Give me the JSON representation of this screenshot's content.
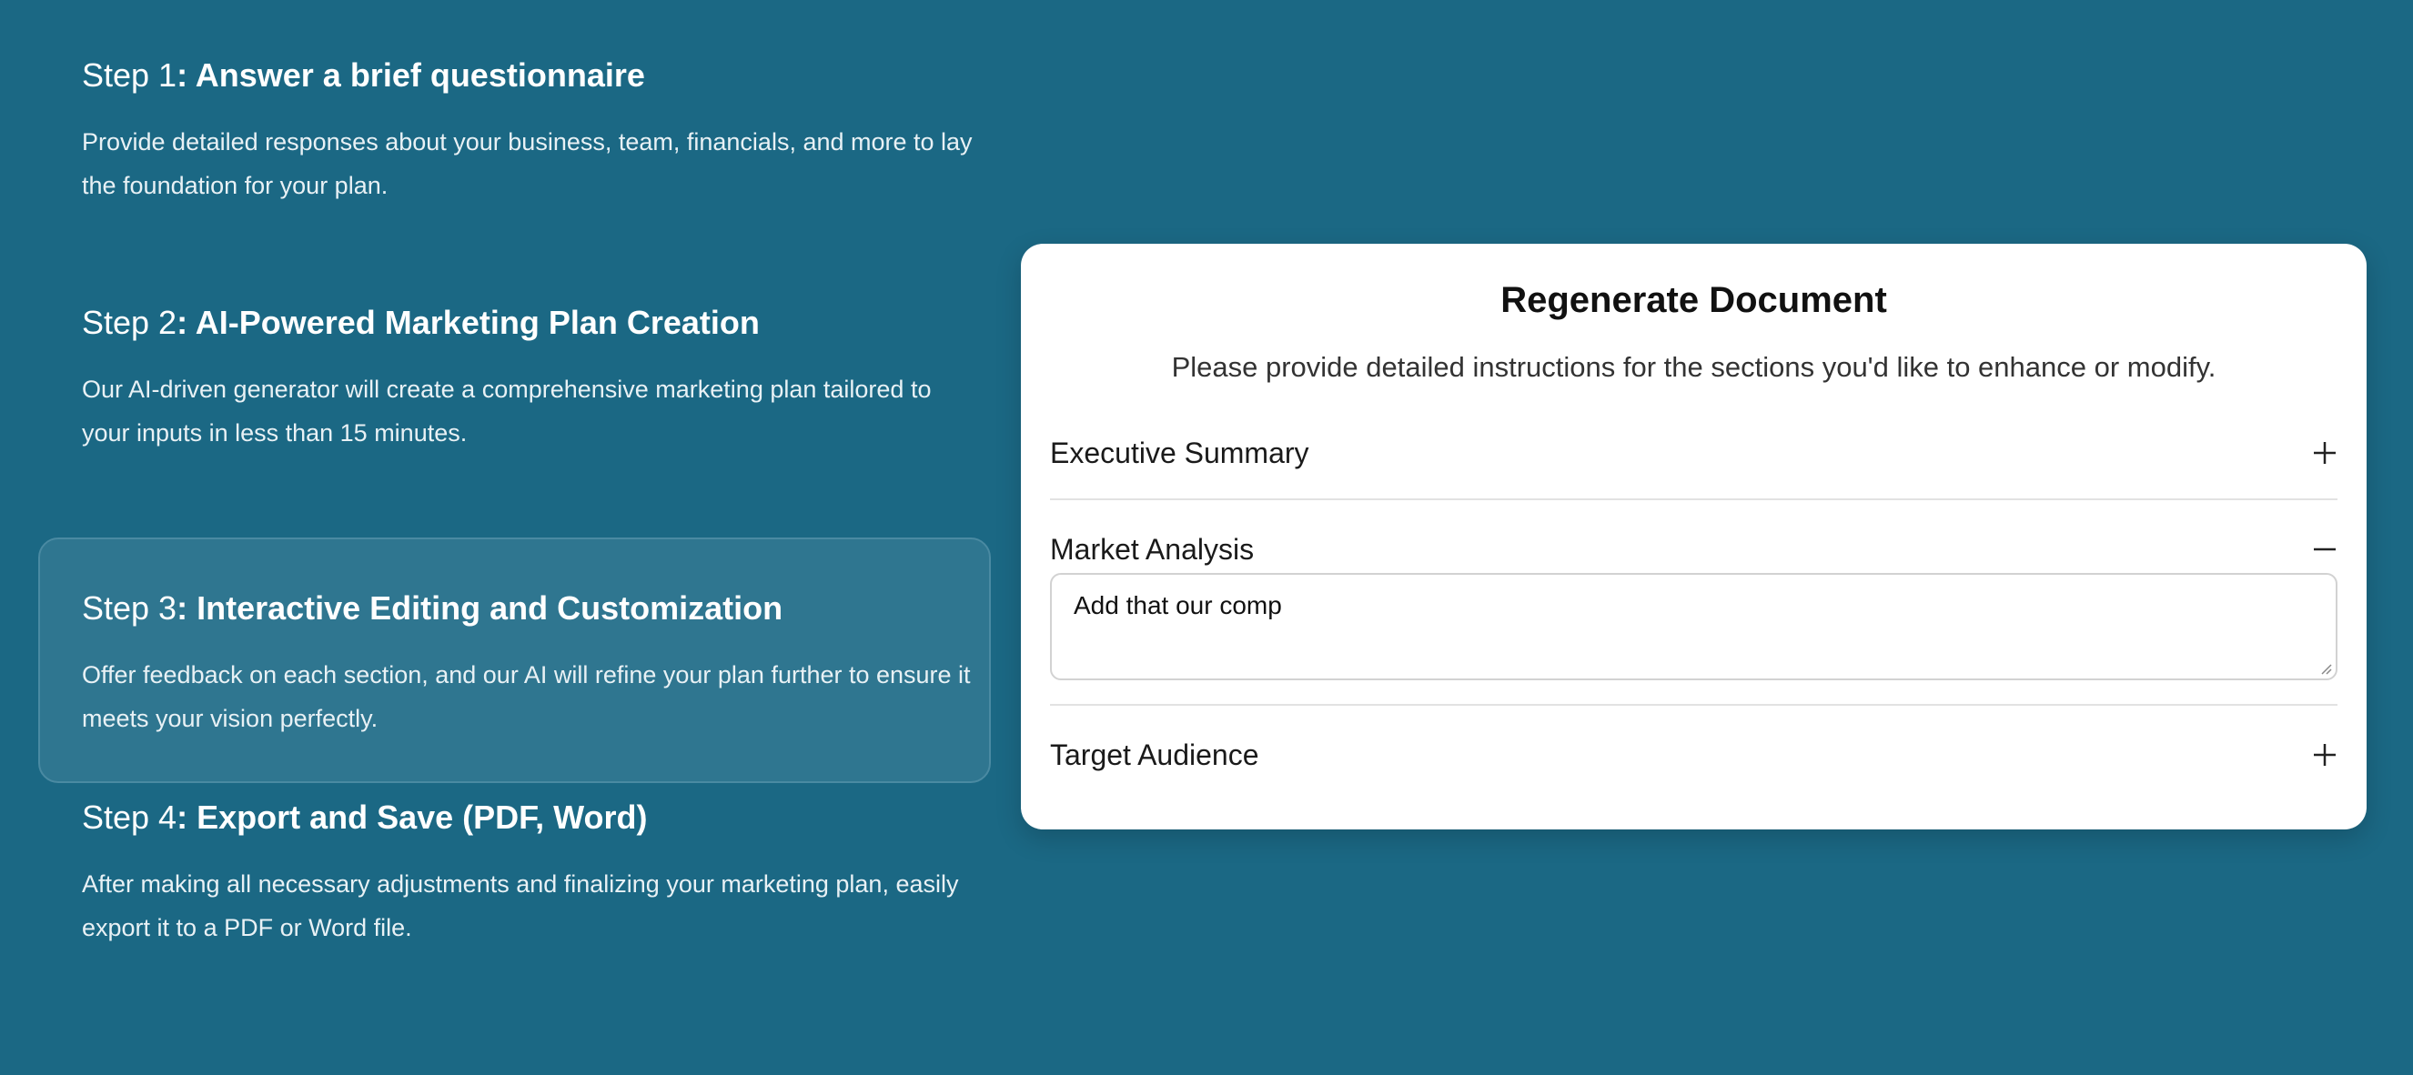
{
  "steps": [
    {
      "prefix": "Step 1",
      "title": ": Answer a brief questionnaire",
      "description": "Provide detailed responses about your business, team, financials, and more to lay the foundation for your plan."
    },
    {
      "prefix": "Step 2",
      "title": ": AI-Powered Marketing Plan Creation",
      "description": "Our AI-driven generator will create a comprehensive marketing plan tailored to your inputs in less than 15 minutes."
    },
    {
      "prefix": "Step 3",
      "title": ": Interactive Editing and Customization",
      "description": "Offer feedback on each section, and our AI will refine your plan further to ensure it meets your vision perfectly."
    },
    {
      "prefix": "Step 4",
      "title": ": Export and Save (PDF, Word)",
      "description": "After making all necessary adjustments and finalizing your marketing plan, easily export it to a PDF or Word file."
    }
  ],
  "card": {
    "title": "Regenerate Document",
    "subtitle": "Please provide detailed instructions for the sections you'd like to enhance or modify.",
    "sections": [
      {
        "label": "Executive Summary",
        "icon": "plus-icon"
      },
      {
        "label": "Market Analysis",
        "icon": "minus-icon",
        "input_value": "Add that our comp"
      },
      {
        "label": "Target Audience",
        "icon": "plus-icon"
      }
    ]
  },
  "colors": {
    "background": "#1b6884",
    "active_step": "#2f7690",
    "card": "#ffffff"
  }
}
